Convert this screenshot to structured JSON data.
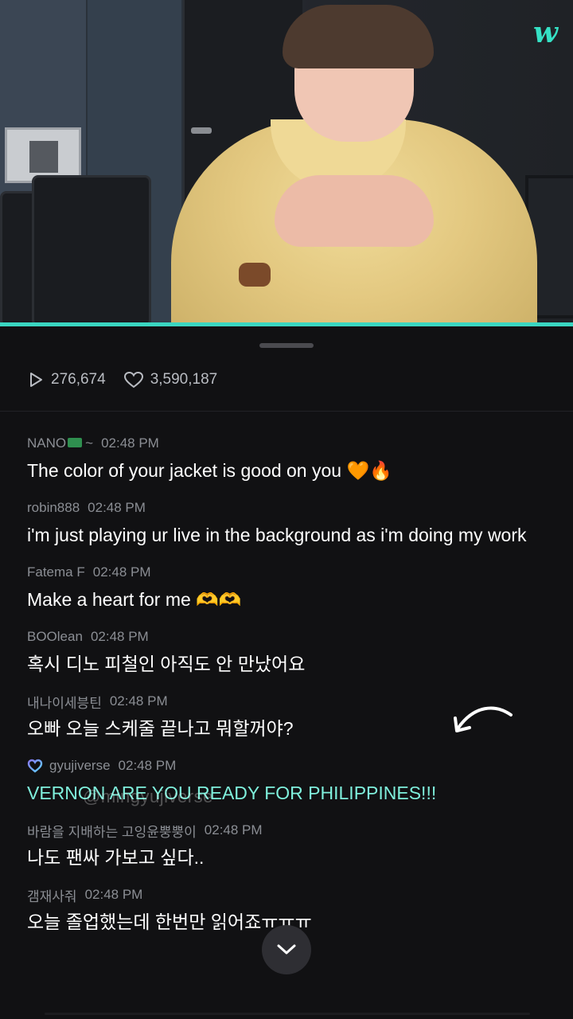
{
  "app": {
    "logo_text": "w",
    "accent_color": "#3ad6c1"
  },
  "stats": {
    "plays": "276,674",
    "likes": "3,590,187"
  },
  "comments": [
    {
      "user": "NANO",
      "user_suffix": "~",
      "time": "02:48 PM",
      "text": "The color of your jacket is good on you 🧡🔥"
    },
    {
      "user": "robin888",
      "time": "02:48 PM",
      "text": "i'm just playing ur live in the background as i'm doing my work"
    },
    {
      "user": "Fatema F",
      "time": "02:48 PM",
      "text": "Make a heart for me 🫶🫶"
    },
    {
      "user": "BOOlean",
      "time": "02:48 PM",
      "text": "혹시 디노 피철인 아직도 안 만났어요"
    },
    {
      "user": "내나이세븡틴",
      "time": "02:48 PM",
      "text": "오빠 오늘 스케줄 끝나고 뭐할꺼야?"
    },
    {
      "user": "gyujiverse",
      "time": "02:48 PM",
      "text": "VERNON ARE YOU READY FOR PHILIPPINES!!!"
    },
    {
      "user": "바람을 지배하는 고잉윤뿡뿡이",
      "time": "02:48 PM",
      "text": "나도 팬싸 가보고 싶다.."
    },
    {
      "user": "갬재사줘",
      "time": "02:48 PM",
      "text": "오늘 졸업했는데 한번만 읽어죠ㅠㅠㅠ"
    }
  ],
  "watermark": "@mingyujiverse",
  "icons": {
    "play": "play-icon",
    "heart": "heart-icon",
    "scroll_down": "chevron-down-icon"
  }
}
